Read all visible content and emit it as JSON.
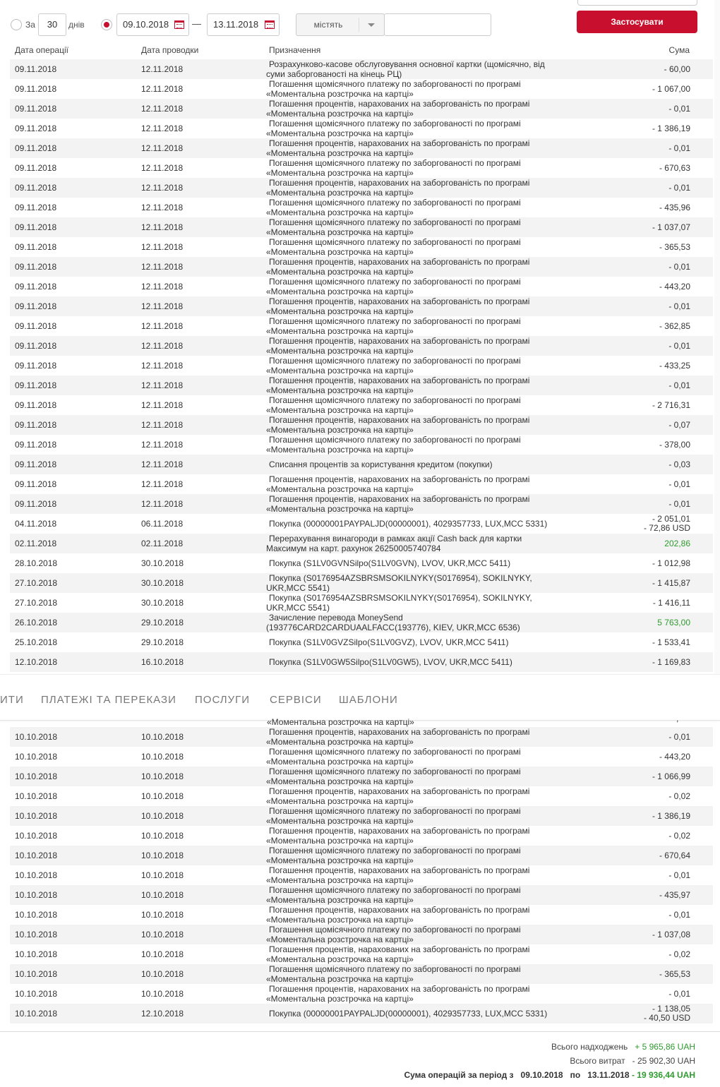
{
  "filters": {
    "period_prefix": "За",
    "period_days": "30",
    "period_suffix": "днів",
    "date_from": "09.10.2018",
    "date_separator": "—",
    "date_to": "13.11.2018",
    "search_mode": "містять",
    "search_value": "",
    "apply_label": "Застосувати"
  },
  "table": {
    "headers": [
      "Дата операції",
      "Дата проводки",
      "Призначення",
      "Сума"
    ],
    "rows_top": [
      {
        "op": "09.11.2018",
        "post": "12.11.2018",
        "desc": [
          "Розрахунково-касове обслуговування основної картки (щомісячно, від",
          "суми заборгованості на кінець РЦ)"
        ],
        "amt": [
          "- 60,00"
        ]
      },
      {
        "op": "09.11.2018",
        "post": "12.11.2018",
        "desc": [
          "Погашення щомісячного платежу по заборгованості по програмі",
          "«Моментальна розстрочка на картці»"
        ],
        "amt": [
          "- 1 067,00"
        ]
      },
      {
        "op": "09.11.2018",
        "post": "12.11.2018",
        "desc": [
          "Погашення процентів, нарахованих на заборгованість по програмі",
          "«Моментальна розстрочка на картці»"
        ],
        "amt": [
          "- 0,01"
        ]
      },
      {
        "op": "09.11.2018",
        "post": "12.11.2018",
        "desc": [
          "Погашення щомісячного платежу по заборгованості по програмі",
          "«Моментальна розстрочка на картці»"
        ],
        "amt": [
          "- 1 386,19"
        ]
      },
      {
        "op": "09.11.2018",
        "post": "12.11.2018",
        "desc": [
          "Погашення процентів, нарахованих на заборгованість по програмі",
          "«Моментальна розстрочка на картці»"
        ],
        "amt": [
          "- 0,01"
        ]
      },
      {
        "op": "09.11.2018",
        "post": "12.11.2018",
        "desc": [
          "Погашення щомісячного платежу по заборгованості по програмі",
          "«Моментальна розстрочка на картці»"
        ],
        "amt": [
          "- 670,63"
        ]
      },
      {
        "op": "09.11.2018",
        "post": "12.11.2018",
        "desc": [
          "Погашення процентів, нарахованих на заборгованість по програмі",
          "«Моментальна розстрочка на картці»"
        ],
        "amt": [
          "- 0,01"
        ]
      },
      {
        "op": "09.11.2018",
        "post": "12.11.2018",
        "desc": [
          "Погашення щомісячного платежу по заборгованості по програмі",
          "«Моментальна розстрочка на картці»"
        ],
        "amt": [
          "- 435,96"
        ]
      },
      {
        "op": "09.11.2018",
        "post": "12.11.2018",
        "desc": [
          "Погашення щомісячного платежу по заборгованості по програмі",
          "«Моментальна розстрочка на картці»"
        ],
        "amt": [
          "- 1 037,07"
        ]
      },
      {
        "op": "09.11.2018",
        "post": "12.11.2018",
        "desc": [
          "Погашення щомісячного платежу по заборгованості по програмі",
          "«Моментальна розстрочка на картці»"
        ],
        "amt": [
          "- 365,53"
        ]
      },
      {
        "op": "09.11.2018",
        "post": "12.11.2018",
        "desc": [
          "Погашення процентів, нарахованих на заборгованість по програмі",
          "«Моментальна розстрочка на картці»"
        ],
        "amt": [
          "- 0,01"
        ]
      },
      {
        "op": "09.11.2018",
        "post": "12.11.2018",
        "desc": [
          "Погашення щомісячного платежу по заборгованості по програмі",
          "«Моментальна розстрочка на картці»"
        ],
        "amt": [
          "- 443,20"
        ]
      },
      {
        "op": "09.11.2018",
        "post": "12.11.2018",
        "desc": [
          "Погашення процентів, нарахованих на заборгованість по програмі",
          "«Моментальна розстрочка на картці»"
        ],
        "amt": [
          "- 0,01"
        ]
      },
      {
        "op": "09.11.2018",
        "post": "12.11.2018",
        "desc": [
          "Погашення щомісячного платежу по заборгованості по програмі",
          "«Моментальна розстрочка на картці»"
        ],
        "amt": [
          "- 362,85"
        ]
      },
      {
        "op": "09.11.2018",
        "post": "12.11.2018",
        "desc": [
          "Погашення процентів, нарахованих на заборгованість по програмі",
          "«Моментальна розстрочка на картці»"
        ],
        "amt": [
          "- 0,01"
        ]
      },
      {
        "op": "09.11.2018",
        "post": "12.11.2018",
        "desc": [
          "Погашення щомісячного платежу по заборгованості по програмі",
          "«Моментальна розстрочка на картці»"
        ],
        "amt": [
          "- 433,25"
        ]
      },
      {
        "op": "09.11.2018",
        "post": "12.11.2018",
        "desc": [
          "Погашення процентів, нарахованих на заборгованість по програмі",
          "«Моментальна розстрочка на картці»"
        ],
        "amt": [
          "- 0,01"
        ]
      },
      {
        "op": "09.11.2018",
        "post": "12.11.2018",
        "desc": [
          "Погашення щомісячного платежу по заборгованості по програмі",
          "«Моментальна розстрочка на картці»"
        ],
        "amt": [
          "- 2 716,31"
        ]
      },
      {
        "op": "09.11.2018",
        "post": "12.11.2018",
        "desc": [
          "Погашення процентів, нарахованих на заборгованість по програмі",
          "«Моментальна розстрочка на картці»"
        ],
        "amt": [
          "- 0,07"
        ]
      },
      {
        "op": "09.11.2018",
        "post": "12.11.2018",
        "desc": [
          "Погашення щомісячного платежу по заборгованості по програмі",
          "«Моментальна розстрочка на картці»"
        ],
        "amt": [
          "- 378,00"
        ]
      },
      {
        "op": "09.11.2018",
        "post": "12.11.2018",
        "desc": [
          "Списання процентів за користування кредитом (покупки)"
        ],
        "amt": [
          "- 0,03"
        ]
      },
      {
        "op": "09.11.2018",
        "post": "12.11.2018",
        "desc": [
          "Погашення процентів, нарахованих на заборгованість по програмі",
          "«Моментальна розстрочка на картці»"
        ],
        "amt": [
          "- 0,01"
        ]
      },
      {
        "op": "09.11.2018",
        "post": "12.11.2018",
        "desc": [
          "Погашення процентів, нарахованих на заборгованість по програмі",
          "«Моментальна розстрочка на картці»"
        ],
        "amt": [
          "- 0,01"
        ]
      },
      {
        "op": "04.11.2018",
        "post": "06.11.2018",
        "desc": [
          "Покупка (00000001PAYPALJD(00000001), 4029357733, LUX,MCC 5331)"
        ],
        "amt": [
          "- 2 051,01",
          "- 72,86 USD"
        ]
      },
      {
        "op": "02.11.2018",
        "post": "02.11.2018",
        "desc": [
          "Перерахування винагороди в рамках акції Cash back для картки",
          "Максимум на карт. рахунок 26250005740784"
        ],
        "amt": [
          "202,86"
        ],
        "green": true
      },
      {
        "op": "28.10.2018",
        "post": "30.10.2018",
        "desc": [
          "Покупка (S1LV0GVNSilpo(S1LV0GVN), LVOV, UKR,MCC 5411)"
        ],
        "amt": [
          "- 1 012,98"
        ]
      },
      {
        "op": "27.10.2018",
        "post": "30.10.2018",
        "desc": [
          "Покупка (S0176954AZSBRSMSOKILNYKY(S0176954), SOKILNYKY,",
          "UKR,MCC 5541)"
        ],
        "amt": [
          "- 1 415,87"
        ]
      },
      {
        "op": "27.10.2018",
        "post": "30.10.2018",
        "desc": [
          "Покупка (S0176954AZSBRSMSOKILNYKY(S0176954), SOKILNYKY,",
          "UKR,MCC 5541)"
        ],
        "amt": [
          "- 1 416,11"
        ]
      },
      {
        "op": "26.10.2018",
        "post": "29.10.2018",
        "desc": [
          "Зачисление перевода MoneySend",
          "(193776CARD2CARDUAALFACC(193776), KIEV, UKR,MCC 6536)"
        ],
        "amt": [
          "5 763,00"
        ],
        "green": true
      },
      {
        "op": "25.10.2018",
        "post": "29.10.2018",
        "desc": [
          "Покупка (S1LV0GVZSilpo(S1LV0GVZ), LVOV, UKR,MCC 5411)"
        ],
        "amt": [
          "- 1 533,41"
        ]
      },
      {
        "op": "12.10.2018",
        "post": "16.10.2018",
        "desc": [
          "Покупка (S1LV0GW5Silpo(S1LV0GW5), LVOV, UKR,MCC 5411)"
        ],
        "amt": [
          "- 1 169,83"
        ]
      }
    ],
    "clipped_text": "«Моментальна розстрочка на картці»",
    "clipped_amount": ",",
    "rows_bottom": [
      {
        "op": "10.10.2018",
        "post": "10.10.2018",
        "desc": [
          "Погашення процентів, нарахованих на заборгованість по програмі",
          "«Моментальна розстрочка на картці»"
        ],
        "amt": [
          "- 0,01"
        ]
      },
      {
        "op": "10.10.2018",
        "post": "10.10.2018",
        "desc": [
          "Погашення щомісячного платежу по заборгованості по програмі",
          "«Моментальна розстрочка на картці»"
        ],
        "amt": [
          "- 443,20"
        ]
      },
      {
        "op": "10.10.2018",
        "post": "10.10.2018",
        "desc": [
          "Погашення щомісячного платежу по заборгованості по програмі",
          "«Моментальна розстрочка на картці»"
        ],
        "amt": [
          "- 1 066,99"
        ]
      },
      {
        "op": "10.10.2018",
        "post": "10.10.2018",
        "desc": [
          "Погашення процентів, нарахованих на заборгованість по програмі",
          "«Моментальна розстрочка на картці»"
        ],
        "amt": [
          "- 0,02"
        ]
      },
      {
        "op": "10.10.2018",
        "post": "10.10.2018",
        "desc": [
          "Погашення щомісячного платежу по заборгованості по програмі",
          "«Моментальна розстрочка на картці»"
        ],
        "amt": [
          "- 1 386,19"
        ]
      },
      {
        "op": "10.10.2018",
        "post": "10.10.2018",
        "desc": [
          "Погашення процентів, нарахованих на заборгованість по програмі",
          "«Моментальна розстрочка на картці»"
        ],
        "amt": [
          "- 0,02"
        ]
      },
      {
        "op": "10.10.2018",
        "post": "10.10.2018",
        "desc": [
          "Погашення щомісячного платежу по заборгованості по програмі",
          "«Моментальна розстрочка на картці»"
        ],
        "amt": [
          "- 670,64"
        ]
      },
      {
        "op": "10.10.2018",
        "post": "10.10.2018",
        "desc": [
          "Погашення процентів, нарахованих на заборгованість по програмі",
          "«Моментальна розстрочка на картці»"
        ],
        "amt": [
          "- 0,01"
        ]
      },
      {
        "op": "10.10.2018",
        "post": "10.10.2018",
        "desc": [
          "Погашення щомісячного платежу по заборгованості по програмі",
          "«Моментальна розстрочка на картці»"
        ],
        "amt": [
          "- 435,97"
        ]
      },
      {
        "op": "10.10.2018",
        "post": "10.10.2018",
        "desc": [
          "Погашення процентів, нарахованих на заборгованість по програмі",
          "«Моментальна розстрочка на картці»"
        ],
        "amt": [
          "- 0,01"
        ]
      },
      {
        "op": "10.10.2018",
        "post": "10.10.2018",
        "desc": [
          "Погашення щомісячного платежу по заборгованості по програмі",
          "«Моментальна розстрочка на картці»"
        ],
        "amt": [
          "- 1 037,08"
        ]
      },
      {
        "op": "10.10.2018",
        "post": "10.10.2018",
        "desc": [
          "Погашення процентів, нарахованих на заборгованість по програмі",
          "«Моментальна розстрочка на картці»"
        ],
        "amt": [
          "- 0,02"
        ]
      },
      {
        "op": "10.10.2018",
        "post": "10.10.2018",
        "desc": [
          "Погашення щомісячного платежу по заборгованості по програмі",
          "«Моментальна розстрочка на картці»"
        ],
        "amt": [
          "- 365,53"
        ]
      },
      {
        "op": "10.10.2018",
        "post": "10.10.2018",
        "desc": [
          "Погашення процентів, нарахованих на заборгованість по програмі",
          "«Моментальна розстрочка на картці»"
        ],
        "amt": [
          "- 0,01"
        ]
      },
      {
        "op": "10.10.2018",
        "post": "12.10.2018",
        "desc": [
          "Покупка (00000001PAYPALJD(00000001), 4029357733, LUX,MCC 5331)"
        ],
        "amt": [
          "- 1 138,05",
          "- 40,50 USD"
        ]
      }
    ]
  },
  "nav": {
    "items": [
      "ИТИ",
      "ПЛАТЕЖІ ТА ПЕРЕКАЗИ",
      "ПОСЛУГИ",
      "СЕРВІСИ",
      "ШАБЛОНИ"
    ]
  },
  "totals": {
    "income_label": "Всього надходжень",
    "income_value": "+ 5 965,86 UAH",
    "expense_label": "Всього витрат",
    "expense_value": "- 25 902,30 UAH",
    "period_label": "Сума операцій за період з",
    "period_from": "09.10.2018",
    "period_to_label": "по",
    "period_to": "13.11.2018",
    "period_sum": "- 19 936,44 UAH"
  },
  "colors": {
    "accent": "#c8102e",
    "positive": "#2e9b2e",
    "row_alt": "#f3f3f3"
  }
}
